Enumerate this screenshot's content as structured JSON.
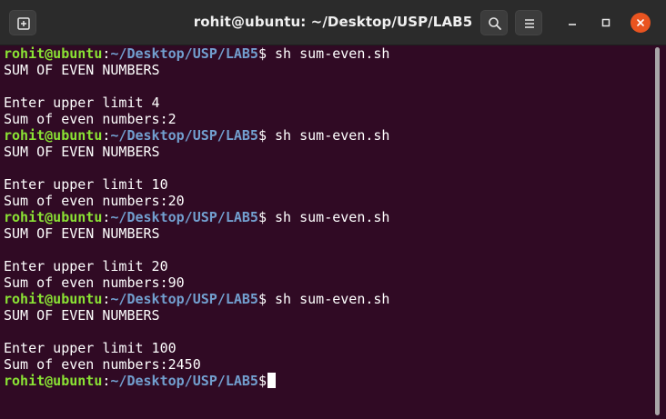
{
  "window": {
    "title": "rohit@ubuntu: ~/Desktop/USP/LAB5"
  },
  "titlebar": {
    "new_tab_icon": "new-tab-icon",
    "search_icon": "search-icon",
    "menu_icon": "hamburger-menu-icon",
    "minimize_icon": "minimize-icon",
    "maximize_icon": "maximize-icon",
    "close_icon": "close-icon"
  },
  "colors": {
    "terminal_bg": "#300a24",
    "prompt_user": "#8ae234",
    "prompt_path": "#729fcf",
    "text": "#ffffff",
    "close_button": "#e95420"
  },
  "terminal": {
    "lines": [
      {
        "user": "rohit@ubuntu",
        "sep": ":",
        "path": "~/Desktop/USP/LAB5",
        "tail": "$ sh sum-even.sh"
      },
      {
        "text": "SUM OF EVEN NUMBERS"
      },
      {
        "text": ""
      },
      {
        "text": "Enter upper limit 4"
      },
      {
        "text": "Sum of even numbers:2"
      },
      {
        "user": "rohit@ubuntu",
        "sep": ":",
        "path": "~/Desktop/USP/LAB5",
        "tail": "$ sh sum-even.sh"
      },
      {
        "text": "SUM OF EVEN NUMBERS"
      },
      {
        "text": ""
      },
      {
        "text": "Enter upper limit 10"
      },
      {
        "text": "Sum of even numbers:20"
      },
      {
        "user": "rohit@ubuntu",
        "sep": ":",
        "path": "~/Desktop/USP/LAB5",
        "tail": "$ sh sum-even.sh"
      },
      {
        "text": "SUM OF EVEN NUMBERS"
      },
      {
        "text": ""
      },
      {
        "text": "Enter upper limit 20"
      },
      {
        "text": "Sum of even numbers:90"
      },
      {
        "user": "rohit@ubuntu",
        "sep": ":",
        "path": "~/Desktop/USP/LAB5",
        "tail": "$ sh sum-even.sh"
      },
      {
        "text": "SUM OF EVEN NUMBERS"
      },
      {
        "text": ""
      },
      {
        "text": "Enter upper limit 100"
      },
      {
        "text": "Sum of even numbers:2450"
      },
      {
        "user": "rohit@ubuntu",
        "sep": ":",
        "path": "~/Desktop/USP/LAB5",
        "tail": "$",
        "cursor": true
      }
    ]
  }
}
